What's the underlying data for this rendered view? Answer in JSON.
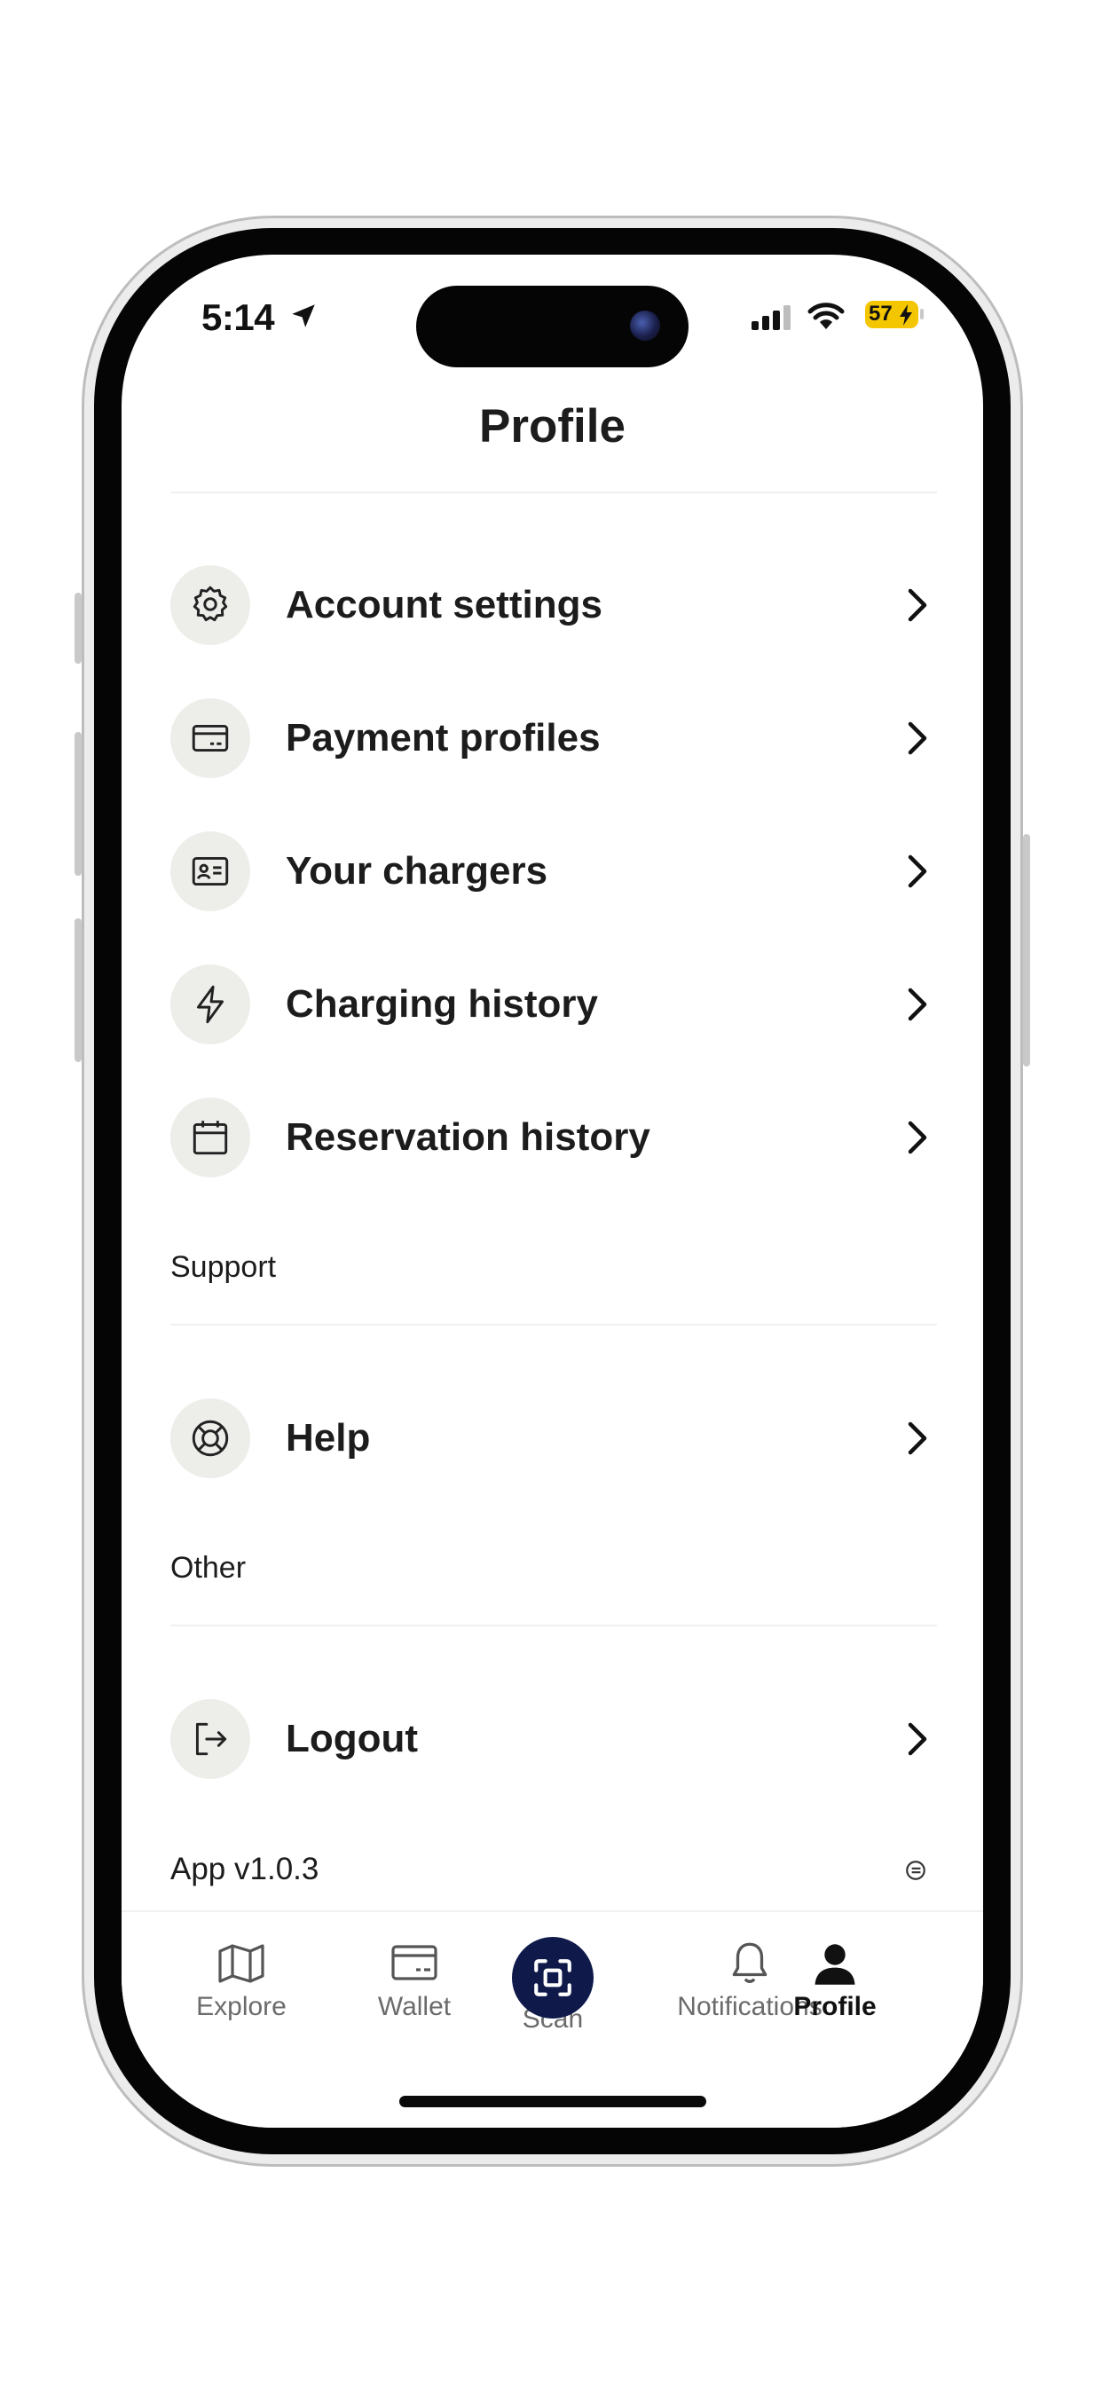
{
  "status_bar": {
    "time": "5:14",
    "battery": "57",
    "battery_color": "#f4c600"
  },
  "header": {
    "title": "Profile"
  },
  "menu": {
    "items": [
      {
        "label": "Account settings",
        "icon": "gear-icon"
      },
      {
        "label": "Payment profiles",
        "icon": "credit-card-icon"
      },
      {
        "label": "Your chargers",
        "icon": "id-card-icon"
      },
      {
        "label": "Charging history",
        "icon": "lightning-icon"
      },
      {
        "label": "Reservation history",
        "icon": "calendar-icon"
      }
    ]
  },
  "support": {
    "section_label": "Support",
    "items": [
      {
        "label": "Help",
        "icon": "lifebuoy-icon"
      }
    ]
  },
  "other": {
    "section_label": "Other",
    "items": [
      {
        "label": "Logout",
        "icon": "logout-icon"
      }
    ]
  },
  "footer": {
    "version": "App v1.0.3"
  },
  "tab_bar": {
    "active": "Profile",
    "accent_color": "#0f1a4b",
    "tabs": [
      {
        "label": "Explore",
        "icon": "map-icon"
      },
      {
        "label": "Wallet",
        "icon": "wallet-icon"
      },
      {
        "label": "Scan",
        "icon": "scan-icon"
      },
      {
        "label": "Notifications",
        "icon": "bell-icon"
      },
      {
        "label": "Profile",
        "icon": "person-icon"
      }
    ]
  }
}
